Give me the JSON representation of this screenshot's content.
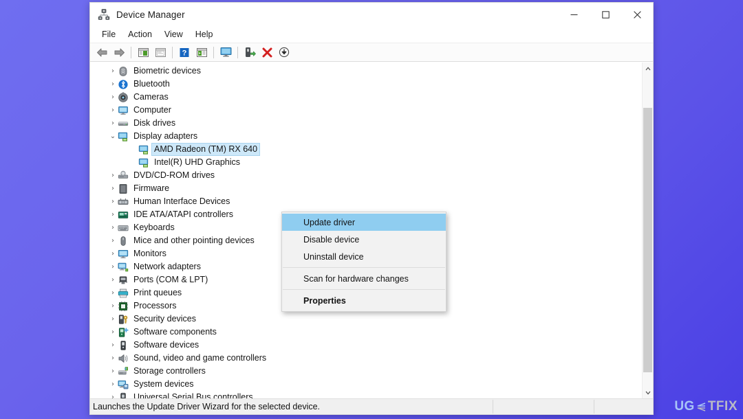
{
  "window": {
    "title": "Device Manager",
    "icon": "device-manager-icon",
    "controls": {
      "minimize": "minimize-icon",
      "maximize": "maximize-icon",
      "close": "close-icon"
    }
  },
  "menubar": {
    "items": [
      {
        "label": "File"
      },
      {
        "label": "Action"
      },
      {
        "label": "View"
      },
      {
        "label": "Help"
      }
    ]
  },
  "toolbar": {
    "buttons": [
      {
        "name": "back-button",
        "icon": "back-arrow-icon"
      },
      {
        "name": "forward-button",
        "icon": "forward-arrow-icon"
      },
      {
        "name": "separator-1",
        "icon": "separator"
      },
      {
        "name": "show-hide-console-tree-button",
        "icon": "console-tree-icon"
      },
      {
        "name": "properties-button",
        "icon": "properties-window-icon"
      },
      {
        "name": "separator-2",
        "icon": "separator"
      },
      {
        "name": "help-button",
        "icon": "help-question-icon"
      },
      {
        "name": "show-hide-action-pane-button",
        "icon": "action-pane-icon"
      },
      {
        "name": "separator-3",
        "icon": "separator"
      },
      {
        "name": "devices-by-type-button",
        "icon": "monitor-icon"
      },
      {
        "name": "separator-4",
        "icon": "separator"
      },
      {
        "name": "scan-for-hardware-changes-button",
        "icon": "scan-hardware-icon"
      },
      {
        "name": "uninstall-device-button",
        "icon": "red-x-icon"
      },
      {
        "name": "update-driver-button",
        "icon": "download-arrow-icon"
      }
    ]
  },
  "tree": {
    "items": [
      {
        "label": "Biometric devices",
        "icon": "biometric-icon",
        "chevron": "›",
        "indent": "parent",
        "selected": false
      },
      {
        "label": "Bluetooth",
        "icon": "bluetooth-icon",
        "chevron": "›",
        "indent": "parent",
        "selected": false
      },
      {
        "label": "Cameras",
        "icon": "camera-icon",
        "chevron": "›",
        "indent": "parent",
        "selected": false
      },
      {
        "label": "Computer",
        "icon": "computer-icon",
        "chevron": "›",
        "indent": "parent",
        "selected": false
      },
      {
        "label": "Disk drives",
        "icon": "disk-drive-icon",
        "chevron": "›",
        "indent": "parent",
        "selected": false
      },
      {
        "label": "Display adapters",
        "icon": "display-adapter-icon",
        "chevron": "⌄",
        "indent": "parent",
        "selected": false
      },
      {
        "label": "AMD Radeon (TM) RX 640",
        "icon": "display-adapter-icon",
        "chevron": "",
        "indent": "child",
        "selected": true
      },
      {
        "label": "Intel(R) UHD Graphics",
        "icon": "display-adapter-icon",
        "chevron": "",
        "indent": "child",
        "selected": false
      },
      {
        "label": "DVD/CD-ROM drives",
        "icon": "dvd-drive-icon",
        "chevron": "›",
        "indent": "parent",
        "selected": false
      },
      {
        "label": "Firmware",
        "icon": "firmware-icon",
        "chevron": "›",
        "indent": "parent",
        "selected": false
      },
      {
        "label": "Human Interface Devices",
        "icon": "hid-icon",
        "chevron": "›",
        "indent": "parent",
        "selected": false
      },
      {
        "label": "IDE ATA/ATAPI controllers",
        "icon": "ide-controller-icon",
        "chevron": "›",
        "indent": "parent",
        "selected": false
      },
      {
        "label": "Keyboards",
        "icon": "keyboard-icon",
        "chevron": "›",
        "indent": "parent",
        "selected": false
      },
      {
        "label": "Mice and other pointing devices",
        "icon": "mouse-icon",
        "chevron": "›",
        "indent": "parent",
        "selected": false
      },
      {
        "label": "Monitors",
        "icon": "monitor-icon",
        "chevron": "›",
        "indent": "parent",
        "selected": false
      },
      {
        "label": "Network adapters",
        "icon": "network-adapter-icon",
        "chevron": "›",
        "indent": "parent",
        "selected": false
      },
      {
        "label": "Ports (COM & LPT)",
        "icon": "port-icon",
        "chevron": "›",
        "indent": "parent",
        "selected": false
      },
      {
        "label": "Print queues",
        "icon": "printer-icon",
        "chevron": "›",
        "indent": "parent",
        "selected": false
      },
      {
        "label": "Processors",
        "icon": "processor-icon",
        "chevron": "›",
        "indent": "parent",
        "selected": false
      },
      {
        "label": "Security devices",
        "icon": "security-device-icon",
        "chevron": "›",
        "indent": "parent",
        "selected": false
      },
      {
        "label": "Software components",
        "icon": "software-component-icon",
        "chevron": "›",
        "indent": "parent",
        "selected": false
      },
      {
        "label": "Software devices",
        "icon": "software-device-icon",
        "chevron": "›",
        "indent": "parent",
        "selected": false
      },
      {
        "label": "Sound, video and game controllers",
        "icon": "sound-icon",
        "chevron": "›",
        "indent": "parent",
        "selected": false
      },
      {
        "label": "Storage controllers",
        "icon": "storage-controller-icon",
        "chevron": "›",
        "indent": "parent",
        "selected": false
      },
      {
        "label": "System devices",
        "icon": "system-device-icon",
        "chevron": "›",
        "indent": "parent",
        "selected": false
      },
      {
        "label": "Universal Serial Bus controllers",
        "icon": "usb-icon",
        "chevron": "›",
        "indent": "parent",
        "selected": false
      }
    ]
  },
  "context_menu": {
    "items": [
      {
        "label": "Update driver",
        "type": "item",
        "highlight": true,
        "bold": false
      },
      {
        "label": "Disable device",
        "type": "item",
        "highlight": false,
        "bold": false
      },
      {
        "label": "Uninstall device",
        "type": "item",
        "highlight": false,
        "bold": false
      },
      {
        "label": "",
        "type": "separator",
        "highlight": false,
        "bold": false
      },
      {
        "label": "Scan for hardware changes",
        "type": "item",
        "highlight": false,
        "bold": false
      },
      {
        "label": "",
        "type": "separator",
        "highlight": false,
        "bold": false
      },
      {
        "label": "Properties",
        "type": "item",
        "highlight": false,
        "bold": true
      }
    ]
  },
  "statusbar": {
    "text": "Launches the Update Driver Wizard for the selected device."
  },
  "watermark": {
    "part_a": "UG",
    "part_b": "TFIX",
    "logo": "ugetfix-logo-icon"
  },
  "colors": {
    "selection_highlight": "#cde8f9",
    "menu_highlight": "#8fcdf0",
    "desktop_start": "#6f6ef0",
    "desktop_end": "#4a3fe4",
    "watermark_a": "#a8c4f7",
    "watermark_b": "#b9b9c6"
  }
}
